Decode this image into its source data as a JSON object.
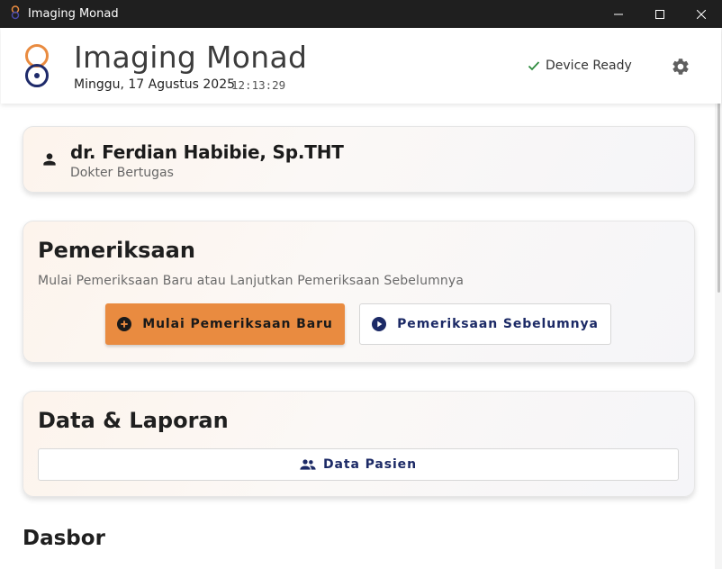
{
  "window": {
    "title": "Imaging Monad"
  },
  "header": {
    "app_name": "Imaging Monad",
    "date": "Minggu, 17 Agustus 2025",
    "time": "12:13:29",
    "device_status": "Device Ready"
  },
  "doctor": {
    "name": "dr. Ferdian Habibie, Sp.THT",
    "role": "Dokter Bertugas"
  },
  "examination": {
    "title": "Pemeriksaan",
    "subtitle": "Mulai Pemeriksaan Baru atau Lanjutkan Pemeriksaan Sebelumnya",
    "new_button": "Mulai Pemeriksaan Baru",
    "previous_button": "Pemeriksaan Sebelumnya"
  },
  "reports": {
    "title": "Data & Laporan",
    "patient_button": "Data Pasien"
  },
  "dashboard": {
    "title": "Dasbor"
  },
  "colors": {
    "accent": "#e98b40",
    "navy": "#1c2a66",
    "status_ok": "#2e8b3e",
    "titlebar": "#1f1f1f"
  },
  "icons": {
    "app": "monad-logo-icon",
    "device": "check-icon",
    "settings": "gear-icon",
    "doctor": "person-icon",
    "new_exam": "plus-circle-icon",
    "previous_exam": "play-circle-icon",
    "patients": "group-icon"
  }
}
